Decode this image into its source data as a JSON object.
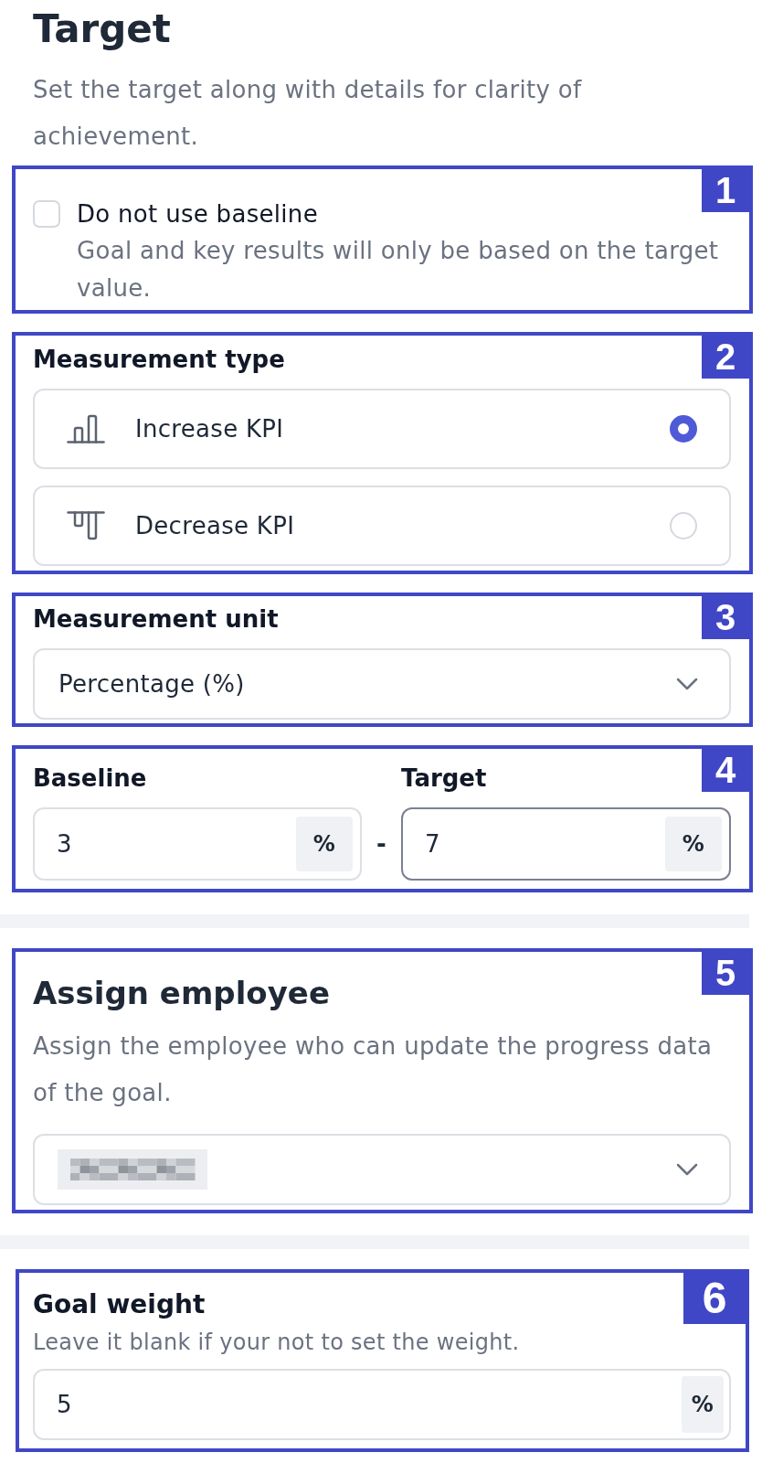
{
  "header": {
    "title": "Target",
    "description": "Set the target along with details for clarity of achievement."
  },
  "groups": [
    {
      "sections": [
        {
          "kind": "checkbox",
          "callout": "1",
          "label": "Do not use baseline",
          "description": "Goal and key results will only be based on the target value.",
          "checked": false
        },
        {
          "kind": "choice",
          "callout": "2",
          "label": "Measurement type",
          "options": [
            {
              "kind": "increase",
              "label": "Increase KPI",
              "selected": true
            },
            {
              "kind": "decrease",
              "label": "Decrease KPI",
              "selected": false
            }
          ]
        },
        {
          "kind": "select",
          "callout": "3",
          "label": "Measurement unit",
          "value": "Percentage (%)"
        },
        {
          "kind": "range",
          "callout": "4",
          "separator": "-",
          "fields": [
            {
              "label": "Baseline",
              "value": "3",
              "unit": "%",
              "focused": false
            },
            {
              "label": "Target",
              "value": "7",
              "unit": "%",
              "focused": true
            }
          ]
        }
      ]
    },
    {
      "sections": [
        {
          "kind": "heading_select",
          "callout": "5",
          "title": "Assign employee",
          "description": "Assign the employee who can update the progress data of the goal.",
          "value_pixelated": true
        }
      ]
    },
    {
      "sections": [
        {
          "kind": "number",
          "callout": "6",
          "label": "Goal weight",
          "description": "Leave it blank if your not to set the weight.",
          "value": "5",
          "unit": "%"
        }
      ]
    }
  ]
}
